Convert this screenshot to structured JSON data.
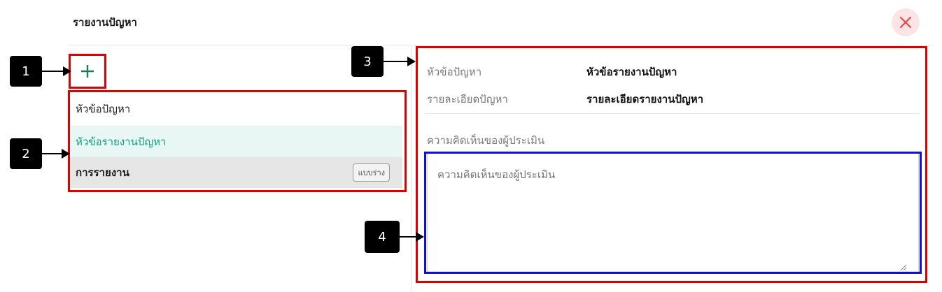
{
  "header": {
    "title": "รายงานปัญหา",
    "close_icon": "close-x-icon",
    "close_color": "#e5484d"
  },
  "left_panel": {
    "add_icon": "plus-icon",
    "add_color": "#1f7a5a",
    "list_header": "หัวข้อปัญหา",
    "items": [
      {
        "label": "หัวข้อรายงานปัญหา",
        "selected": true
      },
      {
        "label": "การรายงาน",
        "badge": "แบบร่าง"
      }
    ]
  },
  "details": {
    "topic_label": "หัวข้อปัญหา",
    "topic_value": "หัวข้อรายงานปัญหา",
    "desc_label": "รายละเอียดปัญหา",
    "desc_value": "รายละเอียดรายงานปัญหา",
    "comment_label": "ความคิดเห็นของผู้ประเมิน",
    "comment_placeholder": "ความคิดเห็นของผู้ประเมิน"
  },
  "callouts": [
    "1",
    "2",
    "3",
    "4"
  ],
  "colors": {
    "selected_bg": "#e8f7f4",
    "selected_text": "#139a83",
    "annotation_red": "#e00000",
    "annotation_blue": "#1010d0"
  }
}
